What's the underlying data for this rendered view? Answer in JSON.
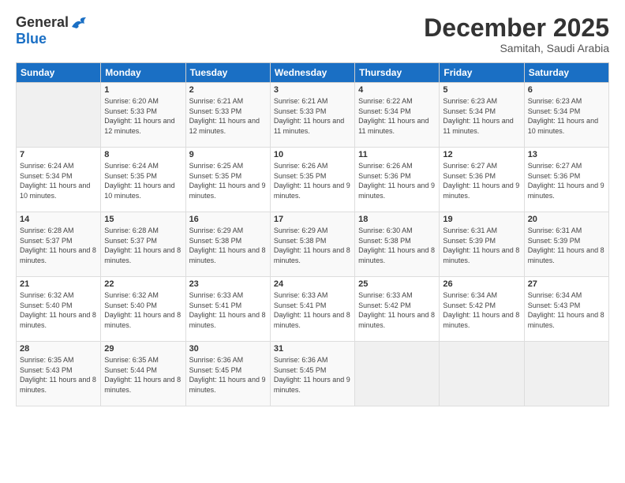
{
  "logo": {
    "general": "General",
    "blue": "Blue"
  },
  "title": "December 2025",
  "subtitle": "Samitah, Saudi Arabia",
  "days_header": [
    "Sunday",
    "Monday",
    "Tuesday",
    "Wednesday",
    "Thursday",
    "Friday",
    "Saturday"
  ],
  "weeks": [
    [
      {
        "day": "",
        "sunrise": "",
        "sunset": "",
        "daylight": ""
      },
      {
        "day": "1",
        "sunrise": "Sunrise: 6:20 AM",
        "sunset": "Sunset: 5:33 PM",
        "daylight": "Daylight: 11 hours and 12 minutes."
      },
      {
        "day": "2",
        "sunrise": "Sunrise: 6:21 AM",
        "sunset": "Sunset: 5:33 PM",
        "daylight": "Daylight: 11 hours and 12 minutes."
      },
      {
        "day": "3",
        "sunrise": "Sunrise: 6:21 AM",
        "sunset": "Sunset: 5:33 PM",
        "daylight": "Daylight: 11 hours and 11 minutes."
      },
      {
        "day": "4",
        "sunrise": "Sunrise: 6:22 AM",
        "sunset": "Sunset: 5:34 PM",
        "daylight": "Daylight: 11 hours and 11 minutes."
      },
      {
        "day": "5",
        "sunrise": "Sunrise: 6:23 AM",
        "sunset": "Sunset: 5:34 PM",
        "daylight": "Daylight: 11 hours and 11 minutes."
      },
      {
        "day": "6",
        "sunrise": "Sunrise: 6:23 AM",
        "sunset": "Sunset: 5:34 PM",
        "daylight": "Daylight: 11 hours and 10 minutes."
      }
    ],
    [
      {
        "day": "7",
        "sunrise": "Sunrise: 6:24 AM",
        "sunset": "Sunset: 5:34 PM",
        "daylight": "Daylight: 11 hours and 10 minutes."
      },
      {
        "day": "8",
        "sunrise": "Sunrise: 6:24 AM",
        "sunset": "Sunset: 5:35 PM",
        "daylight": "Daylight: 11 hours and 10 minutes."
      },
      {
        "day": "9",
        "sunrise": "Sunrise: 6:25 AM",
        "sunset": "Sunset: 5:35 PM",
        "daylight": "Daylight: 11 hours and 9 minutes."
      },
      {
        "day": "10",
        "sunrise": "Sunrise: 6:26 AM",
        "sunset": "Sunset: 5:35 PM",
        "daylight": "Daylight: 11 hours and 9 minutes."
      },
      {
        "day": "11",
        "sunrise": "Sunrise: 6:26 AM",
        "sunset": "Sunset: 5:36 PM",
        "daylight": "Daylight: 11 hours and 9 minutes."
      },
      {
        "day": "12",
        "sunrise": "Sunrise: 6:27 AM",
        "sunset": "Sunset: 5:36 PM",
        "daylight": "Daylight: 11 hours and 9 minutes."
      },
      {
        "day": "13",
        "sunrise": "Sunrise: 6:27 AM",
        "sunset": "Sunset: 5:36 PM",
        "daylight": "Daylight: 11 hours and 9 minutes."
      }
    ],
    [
      {
        "day": "14",
        "sunrise": "Sunrise: 6:28 AM",
        "sunset": "Sunset: 5:37 PM",
        "daylight": "Daylight: 11 hours and 8 minutes."
      },
      {
        "day": "15",
        "sunrise": "Sunrise: 6:28 AM",
        "sunset": "Sunset: 5:37 PM",
        "daylight": "Daylight: 11 hours and 8 minutes."
      },
      {
        "day": "16",
        "sunrise": "Sunrise: 6:29 AM",
        "sunset": "Sunset: 5:38 PM",
        "daylight": "Daylight: 11 hours and 8 minutes."
      },
      {
        "day": "17",
        "sunrise": "Sunrise: 6:29 AM",
        "sunset": "Sunset: 5:38 PM",
        "daylight": "Daylight: 11 hours and 8 minutes."
      },
      {
        "day": "18",
        "sunrise": "Sunrise: 6:30 AM",
        "sunset": "Sunset: 5:38 PM",
        "daylight": "Daylight: 11 hours and 8 minutes."
      },
      {
        "day": "19",
        "sunrise": "Sunrise: 6:31 AM",
        "sunset": "Sunset: 5:39 PM",
        "daylight": "Daylight: 11 hours and 8 minutes."
      },
      {
        "day": "20",
        "sunrise": "Sunrise: 6:31 AM",
        "sunset": "Sunset: 5:39 PM",
        "daylight": "Daylight: 11 hours and 8 minutes."
      }
    ],
    [
      {
        "day": "21",
        "sunrise": "Sunrise: 6:32 AM",
        "sunset": "Sunset: 5:40 PM",
        "daylight": "Daylight: 11 hours and 8 minutes."
      },
      {
        "day": "22",
        "sunrise": "Sunrise: 6:32 AM",
        "sunset": "Sunset: 5:40 PM",
        "daylight": "Daylight: 11 hours and 8 minutes."
      },
      {
        "day": "23",
        "sunrise": "Sunrise: 6:33 AM",
        "sunset": "Sunset: 5:41 PM",
        "daylight": "Daylight: 11 hours and 8 minutes."
      },
      {
        "day": "24",
        "sunrise": "Sunrise: 6:33 AM",
        "sunset": "Sunset: 5:41 PM",
        "daylight": "Daylight: 11 hours and 8 minutes."
      },
      {
        "day": "25",
        "sunrise": "Sunrise: 6:33 AM",
        "sunset": "Sunset: 5:42 PM",
        "daylight": "Daylight: 11 hours and 8 minutes."
      },
      {
        "day": "26",
        "sunrise": "Sunrise: 6:34 AM",
        "sunset": "Sunset: 5:42 PM",
        "daylight": "Daylight: 11 hours and 8 minutes."
      },
      {
        "day": "27",
        "sunrise": "Sunrise: 6:34 AM",
        "sunset": "Sunset: 5:43 PM",
        "daylight": "Daylight: 11 hours and 8 minutes."
      }
    ],
    [
      {
        "day": "28",
        "sunrise": "Sunrise: 6:35 AM",
        "sunset": "Sunset: 5:43 PM",
        "daylight": "Daylight: 11 hours and 8 minutes."
      },
      {
        "day": "29",
        "sunrise": "Sunrise: 6:35 AM",
        "sunset": "Sunset: 5:44 PM",
        "daylight": "Daylight: 11 hours and 8 minutes."
      },
      {
        "day": "30",
        "sunrise": "Sunrise: 6:36 AM",
        "sunset": "Sunset: 5:45 PM",
        "daylight": "Daylight: 11 hours and 9 minutes."
      },
      {
        "day": "31",
        "sunrise": "Sunrise: 6:36 AM",
        "sunset": "Sunset: 5:45 PM",
        "daylight": "Daylight: 11 hours and 9 minutes."
      },
      {
        "day": "",
        "sunrise": "",
        "sunset": "",
        "daylight": ""
      },
      {
        "day": "",
        "sunrise": "",
        "sunset": "",
        "daylight": ""
      },
      {
        "day": "",
        "sunrise": "",
        "sunset": "",
        "daylight": ""
      }
    ]
  ]
}
